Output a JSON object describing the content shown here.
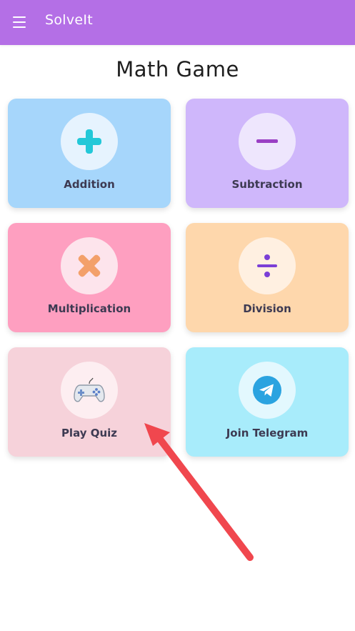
{
  "appbar": {
    "title": "SolveIt",
    "color": "#b46fe6"
  },
  "page": {
    "title": "Math Game"
  },
  "cards": [
    {
      "label": "Addition",
      "icon": "plus-icon",
      "bg": "#a6d6fb",
      "circle": "#e6f3fe"
    },
    {
      "label": "Subtraction",
      "icon": "minus-icon",
      "bg": "#cfb7fb",
      "circle": "#eee6fd"
    },
    {
      "label": "Multiplication",
      "icon": "multiply-icon",
      "bg": "#fe9fc0",
      "circle": "#fde4ec"
    },
    {
      "label": "Division",
      "icon": "divide-icon",
      "bg": "#fed7ac",
      "circle": "#fff0e1"
    },
    {
      "label": "Play Quiz",
      "icon": "gamepad-icon",
      "bg": "#f6d2da",
      "circle": "#fdeef1"
    },
    {
      "label": "Join Telegram",
      "icon": "telegram-icon",
      "bg": "#a8ecfb",
      "circle": "#e3f8fe"
    }
  ],
  "annotation": {
    "icon": "red-arrow-icon",
    "color": "#f0474e"
  }
}
